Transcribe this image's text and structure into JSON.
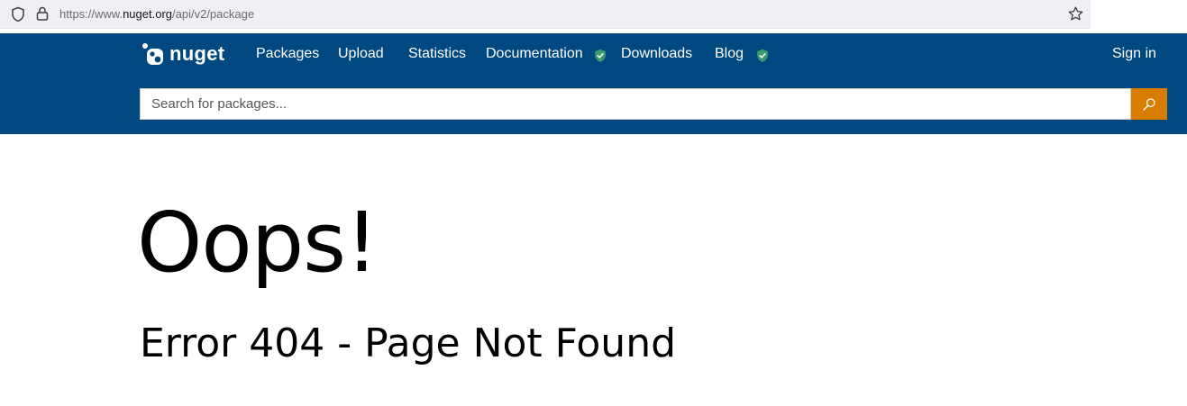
{
  "browser": {
    "url_prefix": "https://www.",
    "url_host": "nuget.org",
    "url_path": "/api/v2/package"
  },
  "header": {
    "logo_text": "nuget",
    "nav": [
      {
        "label": "Packages"
      },
      {
        "label": "Upload"
      },
      {
        "label": "Statistics"
      },
      {
        "label": "Documentation"
      },
      {
        "label": "Downloads"
      },
      {
        "label": "Blog"
      }
    ],
    "sign_in": "Sign in"
  },
  "search": {
    "placeholder": "Search for packages..."
  },
  "colors": {
    "header_bg": "#004880",
    "search_button": "#d77d00",
    "verified_badge": "#3c9b6e"
  },
  "main": {
    "heading": "Oops!",
    "error": "Error 404 - Page Not Found"
  }
}
